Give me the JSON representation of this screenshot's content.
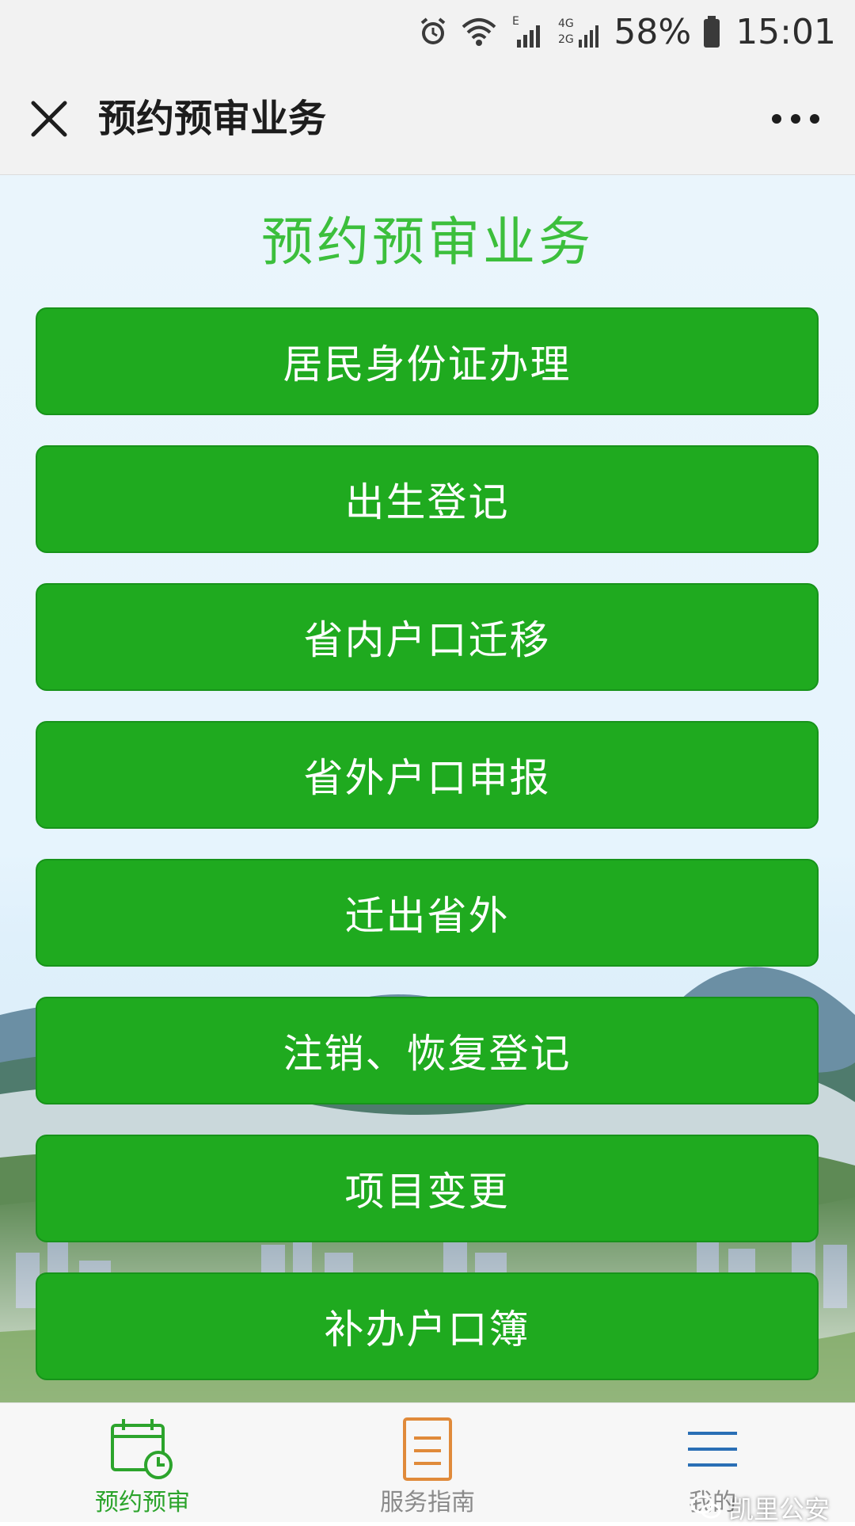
{
  "status_bar": {
    "network_labels": [
      "E",
      "4G",
      "2G"
    ],
    "battery_percent": "58%",
    "time": "15:01",
    "icons": [
      "alarm-icon",
      "wifi-icon",
      "signal-icon",
      "signal-icon",
      "battery-icon"
    ]
  },
  "header": {
    "title": "预约预审业务",
    "close_icon": "close-icon",
    "more_icon": "more-icon"
  },
  "main": {
    "heading": "预约预审业务",
    "buttons": [
      {
        "label": "居民身份证办理"
      },
      {
        "label": "出生登记"
      },
      {
        "label": "省内户口迁移"
      },
      {
        "label": "省外户口申报"
      },
      {
        "label": "迁出省外"
      },
      {
        "label": "注销、恢复登记"
      },
      {
        "label": "项目变更"
      },
      {
        "label": "补办户口簿"
      }
    ]
  },
  "tab_bar": {
    "tabs": [
      {
        "label": "预约预审",
        "icon": "calendar-clock-icon",
        "active": true
      },
      {
        "label": "服务指南",
        "icon": "document-icon",
        "active": false
      },
      {
        "label": "我的",
        "icon": "menu-icon",
        "active": false
      }
    ]
  },
  "watermark": {
    "text": "凯里公安",
    "icon": "wechat-icon"
  },
  "colors": {
    "button_green": "#1faa1f",
    "heading_green": "#3cbf3c",
    "active_tab": "#2ca42c",
    "document_icon": "#e08a3a",
    "menu_icon": "#2a6fb5"
  }
}
